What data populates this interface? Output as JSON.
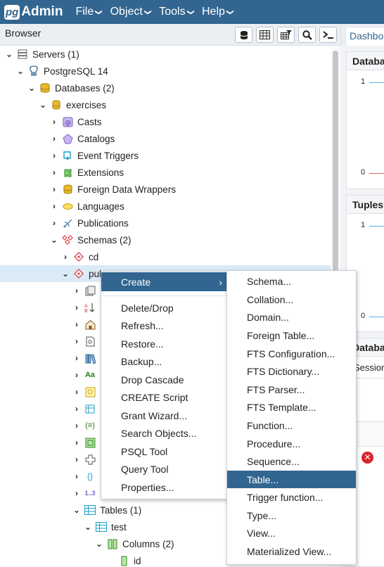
{
  "app": {
    "logo_pg": "pg",
    "logo_text": "Admin"
  },
  "menu": [
    {
      "label": "File"
    },
    {
      "label": "Object"
    },
    {
      "label": "Tools"
    },
    {
      "label": "Help"
    }
  ],
  "browser": {
    "title": "Browser",
    "toolbar_icons": [
      "database-icon",
      "table-icon",
      "filter-table-icon",
      "search-icon",
      "terminal-icon"
    ]
  },
  "right_panel": {
    "tab_label": "Dashboard",
    "card1_title": "Database",
    "card1_tick_top": "1",
    "card1_tick_bottom": "0",
    "card2_title": "Tuples",
    "card2_tick_top": "1",
    "card2_tick_bottom": "0",
    "card3_title": "Database",
    "card3_tab": "Sessions",
    "series_colors": [
      "#5ab4e0",
      "#e06666"
    ]
  },
  "tree": [
    {
      "label": "Servers (1)",
      "icon": "servers-icon"
    },
    {
      "label": "PostgreSQL 14",
      "icon": "elephant-icon"
    },
    {
      "label": "Databases (2)",
      "icon": "databases-icon"
    },
    {
      "label": "exercises",
      "icon": "database-icon"
    },
    {
      "label": "Casts",
      "icon": "casts-icon"
    },
    {
      "label": "Catalogs",
      "icon": "catalogs-icon"
    },
    {
      "label": "Event Triggers",
      "icon": "event-triggers-icon"
    },
    {
      "label": "Extensions",
      "icon": "extensions-icon"
    },
    {
      "label": "Foreign Data Wrappers",
      "icon": "fdw-icon"
    },
    {
      "label": "Languages",
      "icon": "languages-icon"
    },
    {
      "label": "Publications",
      "icon": "publications-icon"
    },
    {
      "label": "Schemas (2)",
      "icon": "schemas-icon"
    },
    {
      "label": "cd",
      "icon": "schema-icon"
    },
    {
      "label": "pul",
      "icon": "schema-icon"
    },
    {
      "label": "Tables (1)",
      "icon": "tables-icon"
    },
    {
      "label": "test",
      "icon": "table-icon"
    },
    {
      "label": "Columns (2)",
      "icon": "columns-icon"
    },
    {
      "label": "id",
      "icon": "column-icon"
    }
  ],
  "context_menu": {
    "create_label": "Create",
    "items": [
      "Delete/Drop",
      "Refresh...",
      "Restore...",
      "Backup...",
      "Drop Cascade",
      "CREATE Script",
      "Grant Wizard...",
      "Search Objects...",
      "PSQL Tool",
      "Query Tool",
      "Properties..."
    ]
  },
  "submenu": {
    "items": [
      "Schema...",
      "Collation...",
      "Domain...",
      "Foreign Table...",
      "FTS Configuration...",
      "FTS Dictionary...",
      "FTS Parser...",
      "FTS Template...",
      "Function...",
      "Procedure...",
      "Sequence...",
      "Table...",
      "Trigger function...",
      "Type...",
      "View...",
      "Materialized View..."
    ],
    "active_index": 11
  }
}
